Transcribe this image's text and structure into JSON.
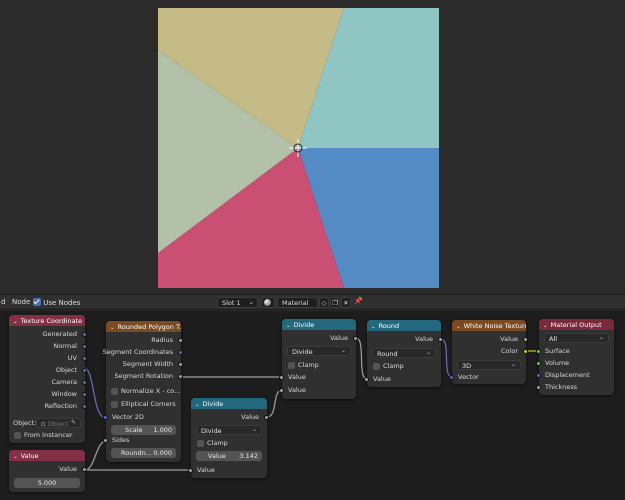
{
  "viewport": {
    "slices": [
      {
        "color": "#8fc5c2"
      },
      {
        "color": "#548bc4"
      },
      {
        "color": "#c94f73"
      },
      {
        "color": "#b2c1a8"
      },
      {
        "color": "#c5bb86"
      }
    ]
  },
  "header": {
    "left_label": "d",
    "node_menu": "Node",
    "use_nodes_label": "Use Nodes",
    "slot": "Slot 1",
    "material_name": "Material"
  },
  "nodes": {
    "texture_coordinate": {
      "title": "Texture Coordinate",
      "outputs": [
        "Generated",
        "Normal",
        "UV",
        "Object",
        "Camera",
        "Window",
        "Reflection"
      ],
      "object_label": "Object:",
      "object_placeholder": "Object",
      "from_instancer": "From Instancer"
    },
    "value": {
      "title": "Value",
      "output": "Value",
      "field": "5.000"
    },
    "rounded_polygon": {
      "title": "Rounded Polygon T...",
      "outputs": [
        "Radius",
        "Segment Coordinates",
        "Segment Width",
        "Segment Rotation"
      ],
      "normalize": "Normalize X - co...",
      "elliptical": "Elliptical Corners",
      "inputs": [
        "Vector 2D",
        "Sides"
      ],
      "scale_label": "Scale",
      "scale_value": "1.000",
      "rounding_label": "Roundn...",
      "rounding_value": "0.000"
    },
    "divide_a": {
      "title": "Divide",
      "output": "Value",
      "operation": "Divide",
      "clamp": "Clamp",
      "inputs": [
        "Value",
        "Value"
      ]
    },
    "divide_b": {
      "title": "Divide",
      "output": "Value",
      "operation": "Divide",
      "clamp": "Clamp",
      "value_label": "Value",
      "value_field": "3.142",
      "input": "Value"
    },
    "round": {
      "title": "Round",
      "output": "Value",
      "operation": "Round",
      "clamp": "Clamp",
      "input": "Value"
    },
    "white_noise": {
      "title": "White Noise Texture",
      "output": "Value",
      "output_color": "Color",
      "dimensions": "3D",
      "input": "Vector"
    },
    "material_output": {
      "title": "Material Output",
      "target": "All",
      "inputs": [
        "Surface",
        "Volume",
        "Displacement",
        "Thickness"
      ]
    }
  }
}
